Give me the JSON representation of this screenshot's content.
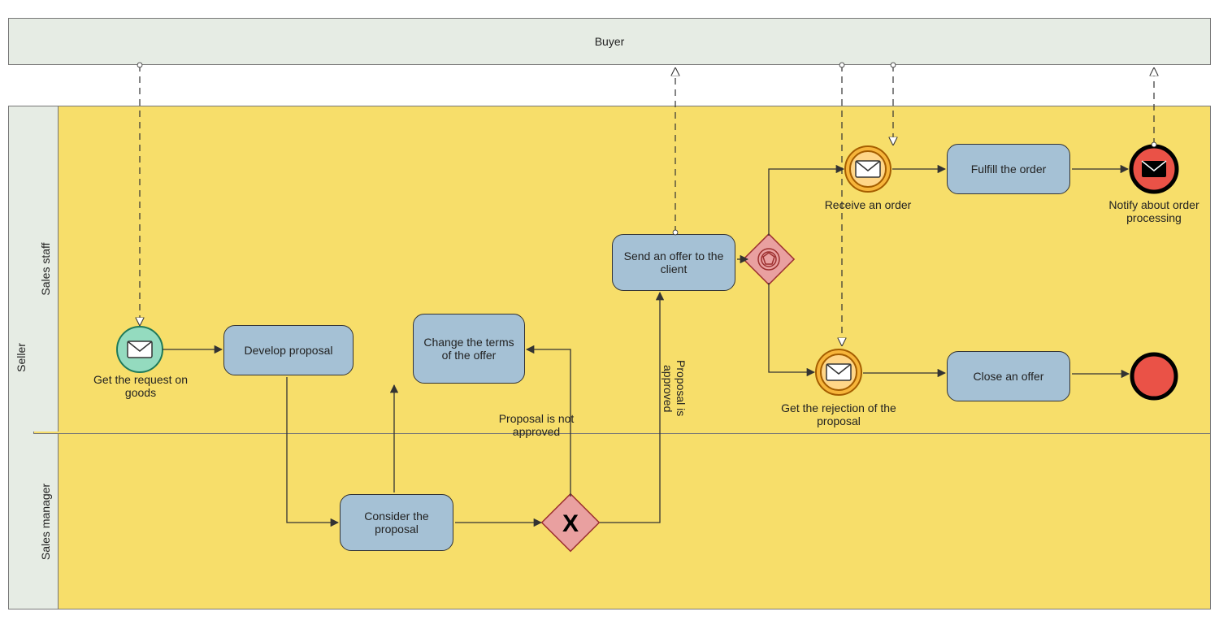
{
  "pools": {
    "buyer": "Buyer",
    "seller": "Seller"
  },
  "lanes": {
    "staff": "Sales staff",
    "manager": "Sales manager"
  },
  "tasks": {
    "develop": "Develop proposal",
    "change": "Change the terms of the offer",
    "consider": "Consider the proposal",
    "send": "Send an offer to the client",
    "fulfill": "Fulfill the order",
    "close": "Close an offer"
  },
  "events": {
    "get_request": "Get the request on goods",
    "receive_order": "Receive an order",
    "get_rejection": "Get the rejection of the proposal",
    "notify": "Notify about order processing"
  },
  "labels": {
    "not_approved": "Proposal is not approved",
    "approved": "Proposal is approved"
  }
}
